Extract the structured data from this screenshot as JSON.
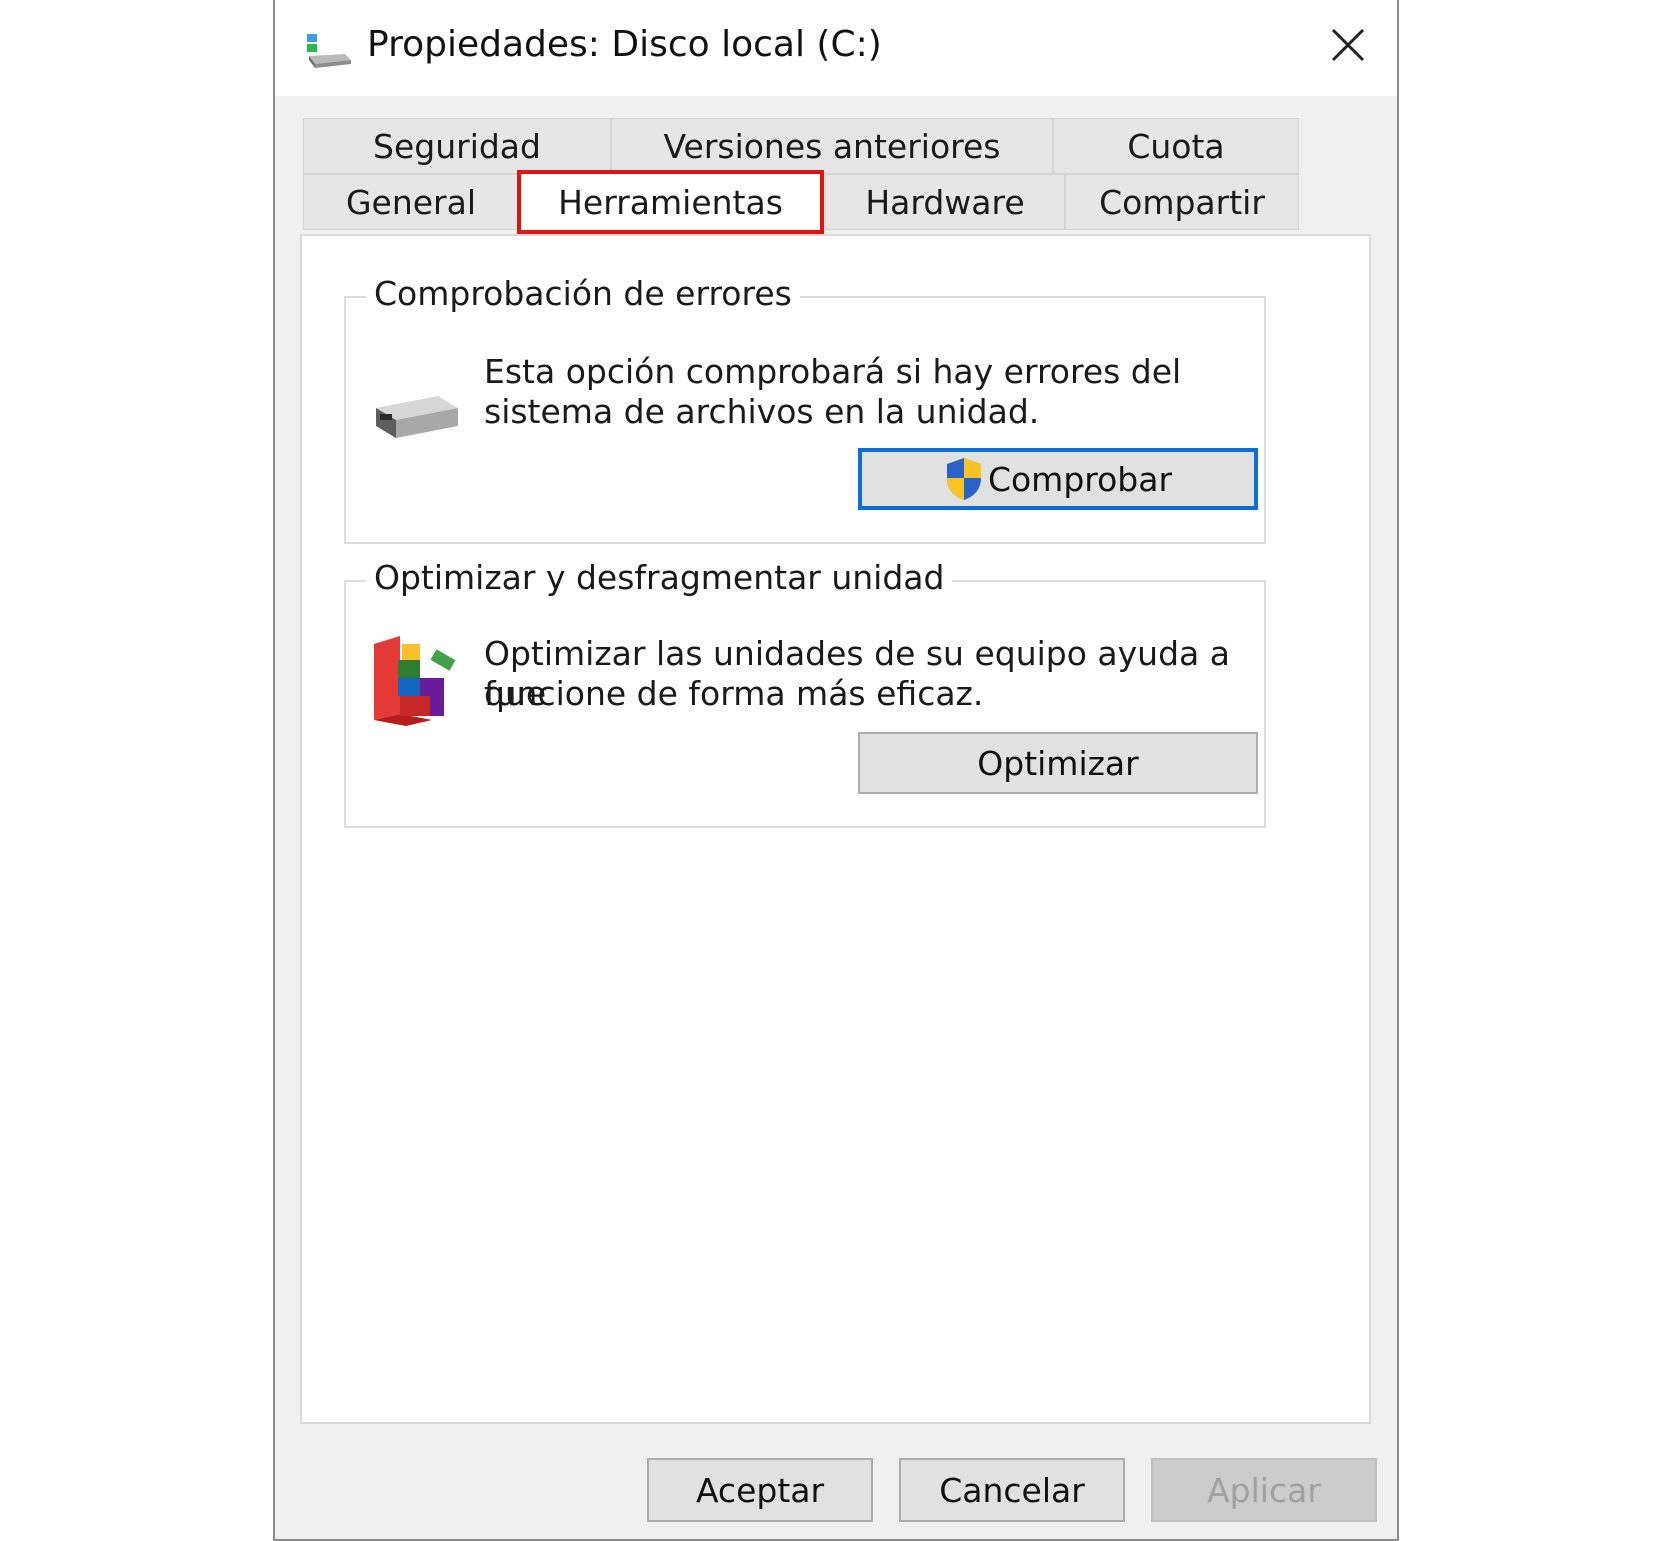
{
  "window": {
    "title": "Propiedades: Disco local (C:)"
  },
  "tabs_row1": [
    "Seguridad",
    "Versiones anteriores",
    "Cuota"
  ],
  "tabs_row2": [
    "General",
    "Herramientas",
    "Hardware",
    "Compartir"
  ],
  "active_tab": "Herramientas",
  "error_check": {
    "title": "Comprobación de errores",
    "line1": "Esta opción comprobará si hay errores del",
    "line2": "sistema de archivos en la unidad.",
    "button": "Comprobar"
  },
  "optimize": {
    "title": "Optimizar y desfragmentar unidad",
    "line1": "Optimizar las unidades de su equipo ayuda a que",
    "line2": "funcione de forma más eficaz.",
    "button": "Optimizar"
  },
  "footer": {
    "ok": "Aceptar",
    "cancel": "Cancelar",
    "apply": "Aplicar"
  },
  "colors": {
    "highlight": "#e11414",
    "focus": "#0a6fd6"
  }
}
